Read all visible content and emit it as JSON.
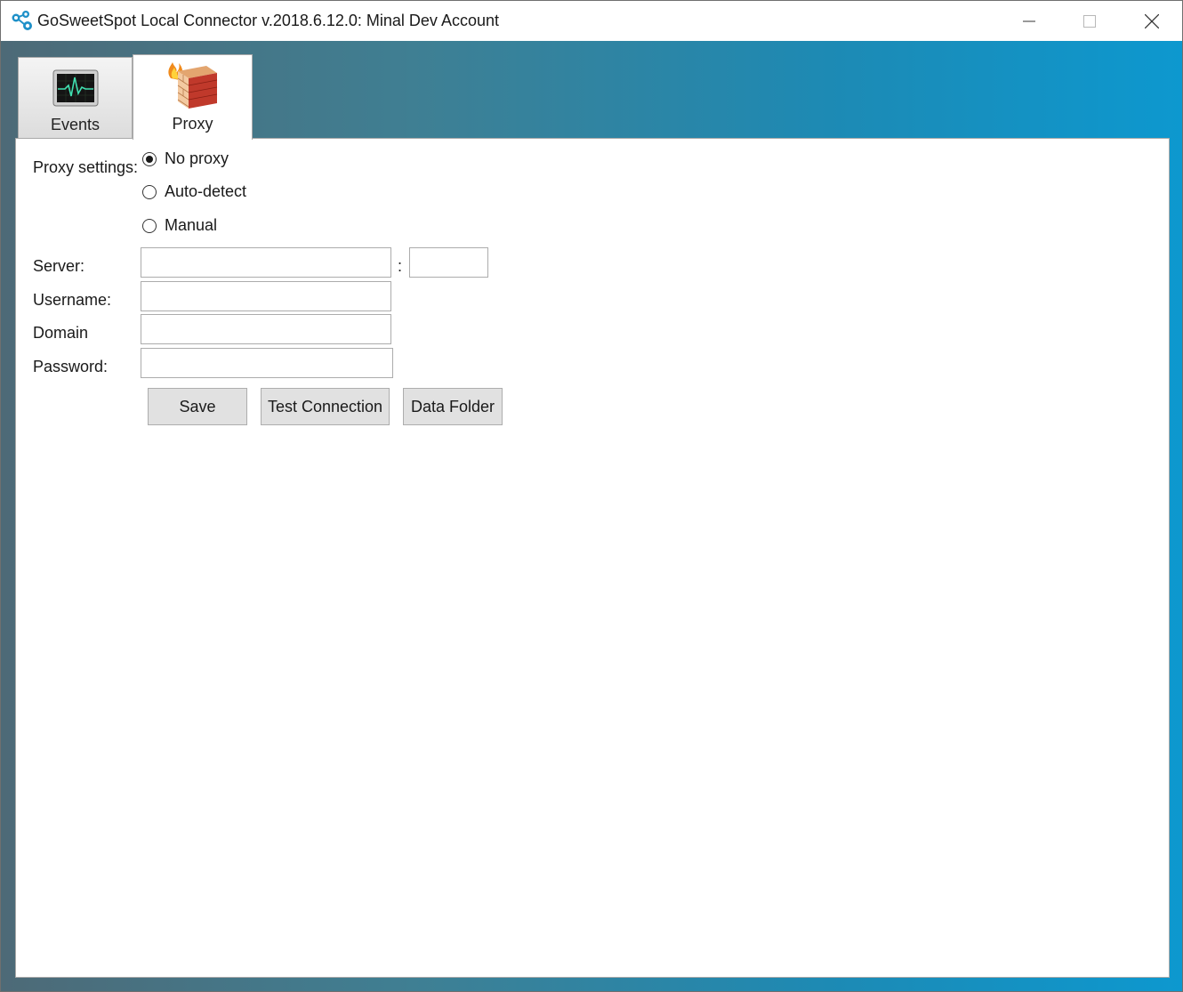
{
  "window": {
    "title": "GoSweetSpot Local Connector v.2018.6.12.0: Minal Dev Account"
  },
  "tabs": [
    {
      "label": "Events",
      "icon": "activity-monitor-icon",
      "selected": false
    },
    {
      "label": "Proxy",
      "icon": "firewall-icon",
      "selected": true
    }
  ],
  "proxy_form": {
    "settings_label": "Proxy settings:",
    "options": [
      {
        "label": "No proxy",
        "checked": true
      },
      {
        "label": "Auto-detect",
        "checked": false
      },
      {
        "label": "Manual",
        "checked": false
      }
    ],
    "server_label": "Server:",
    "server_value": "",
    "port_separator": ":",
    "port_value": "",
    "username_label": "Username:",
    "username_value": "",
    "domain_label": "Domain",
    "domain_value": "",
    "password_label": "Password:",
    "password_value": ""
  },
  "buttons": {
    "save": "Save",
    "test_connection": "Test Connection",
    "data_folder": "Data Folder"
  },
  "colors": {
    "accent": "#0a97d0",
    "background_start": "#4d6a77"
  }
}
